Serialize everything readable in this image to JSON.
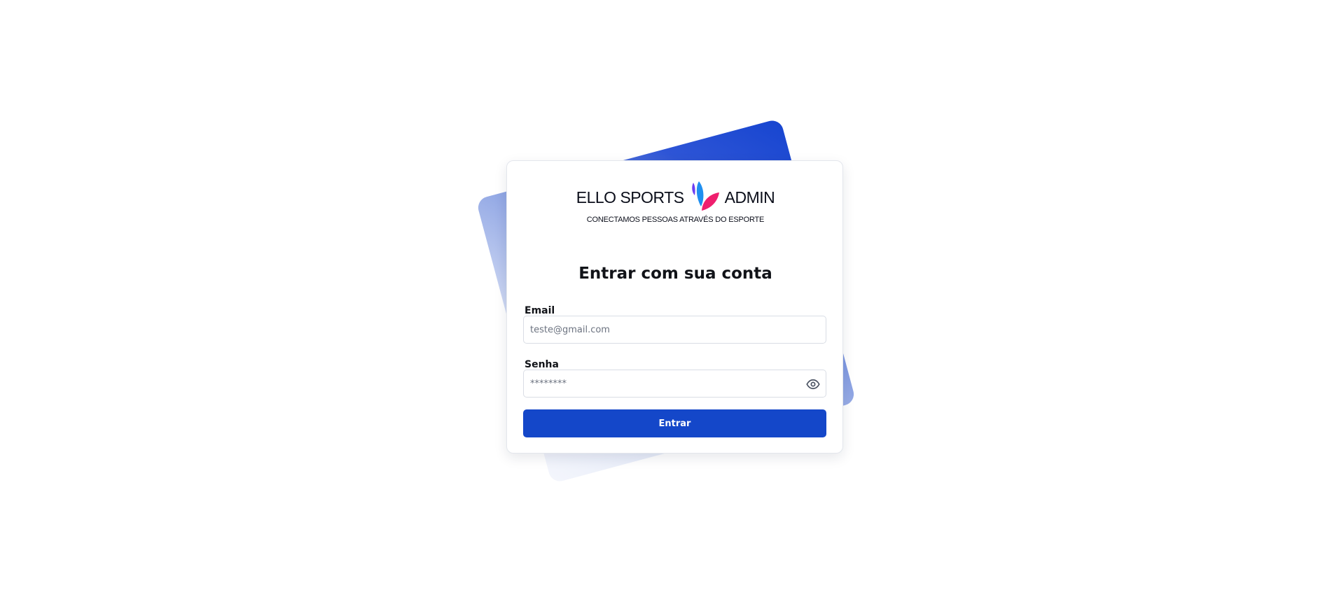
{
  "brand": {
    "name": "ELLO SPORTS",
    "suffix": "ADMIN",
    "tagline": "CONECTAMOS PESSOAS ATRAVÉS DO ESPORTE",
    "mark_icon": "ello-sports-leaf-logo",
    "mark_colors": [
      "#6c3df2",
      "#1f8ff0",
      "#ef1f6e"
    ]
  },
  "login": {
    "title": "Entrar com sua conta",
    "email": {
      "label": "Email",
      "placeholder": "teste@gmail.com",
      "value": ""
    },
    "password": {
      "label": "Senha",
      "placeholder": "********",
      "value": "",
      "toggle_icon": "eye-icon"
    },
    "submit_label": "Entrar"
  },
  "theme": {
    "accent": "#1447c9",
    "text": "#111318",
    "border": "#d9dde5"
  }
}
